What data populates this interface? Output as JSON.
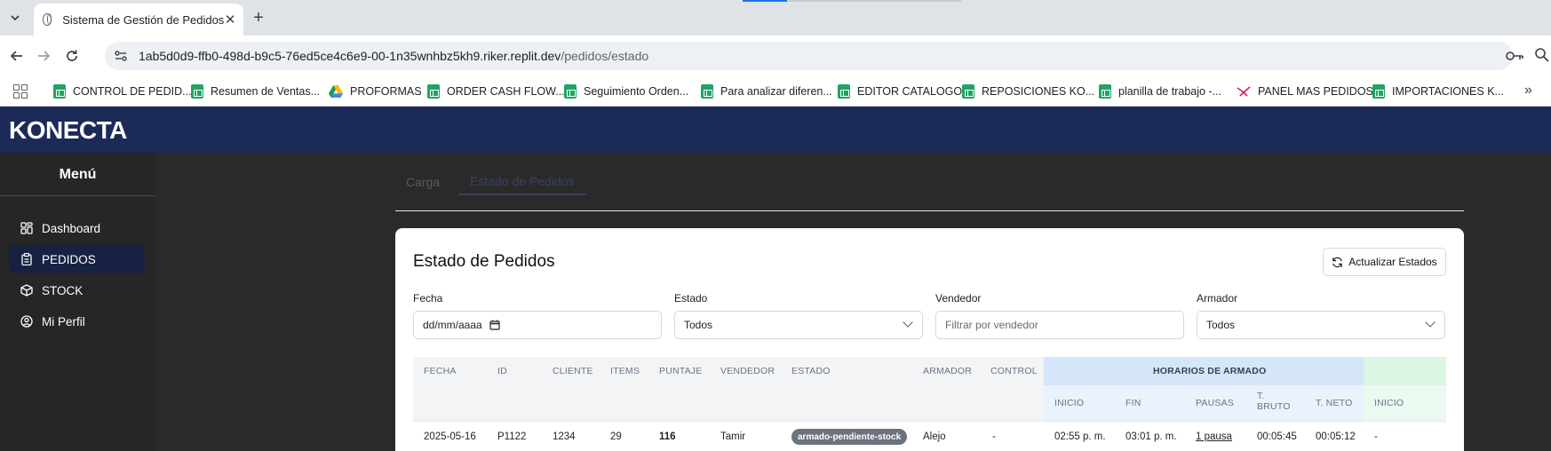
{
  "browser": {
    "tab_title": "Sistema de Gestión de Pedidos",
    "url_host": "1ab5d0d9-ffb0-498d-b9c5-76ed5ce4c6e9-00-1n35wnhbz5kh9.riker.replit.dev",
    "url_path": "/pedidos/estado",
    "bookmarks": [
      {
        "label": "CONTROL DE PEDID...",
        "icon": "sheets-icon"
      },
      {
        "label": "Resumen de Ventas...",
        "icon": "sheets-icon"
      },
      {
        "label": "PROFORMAS",
        "icon": "drive-icon"
      },
      {
        "label": "ORDER CASH FLOW...",
        "icon": "sheets-icon"
      },
      {
        "label": "Seguimiento Orden...",
        "icon": "sheets-icon"
      },
      {
        "label": "Para analizar diferen...",
        "icon": "sheets-icon"
      },
      {
        "label": "EDITOR CATALOGO",
        "icon": "sheets-icon"
      },
      {
        "label": "REPOSICIONES KO...",
        "icon": "sheets-icon"
      },
      {
        "label": "planilla de trabajo -...",
        "icon": "sheets-icon"
      },
      {
        "label": "PANEL MAS PEDIDOS",
        "icon": "panel-icon"
      },
      {
        "label": "IMPORTACIONES K...",
        "icon": "sheets-icon"
      }
    ],
    "more_bookmarks": "»"
  },
  "app": {
    "brand": "KONECTA",
    "menu_title": "Menú",
    "menu": [
      {
        "label": "Dashboard",
        "icon": "dashboard-icon"
      },
      {
        "label": "PEDIDOS",
        "icon": "clipboard-icon"
      },
      {
        "label": "STOCK",
        "icon": "box-icon"
      },
      {
        "label": "Mi Perfil",
        "icon": "user-circle-icon"
      }
    ],
    "tabs": [
      "Carga",
      "Estado de Pedidos"
    ],
    "card_title": "Estado de Pedidos",
    "refresh_label": "Actualizar Estados",
    "filters": {
      "fecha_label": "Fecha",
      "fecha_value": "dd/mm/aaaa",
      "estado_label": "Estado",
      "estado_value": "Todos",
      "vendedor_label": "Vendedor",
      "vendedor_placeholder": "Filtrar por vendedor",
      "armador_label": "Armador",
      "armador_value": "Todos"
    },
    "table": {
      "headers": [
        "FECHA",
        "ID",
        "CLIENTE",
        "ITEMS",
        "PUNTAJE",
        "VENDEDOR",
        "ESTADO",
        "ARMADOR",
        "CONTROL"
      ],
      "group_armado": "HORARIOS DE ARMADO",
      "sub_headers": [
        "INICIO",
        "FIN",
        "PAUSAS",
        "T. BRUTO",
        "T. NETO"
      ],
      "sub_headers_2": [
        "INICIO"
      ],
      "rows": [
        {
          "fecha": "2025-05-16",
          "id": "P1122",
          "cliente": "1234",
          "items": "29",
          "puntaje": "116",
          "vendedor": "Tamir",
          "estado": "armado-pendiente-stock",
          "armador": "Alejo",
          "control": "-",
          "inicio": "02:55 p. m.",
          "fin": "03:01 p. m.",
          "pausas": "1 pausa",
          "t_bruto": "00:05:45",
          "t_neto": "00:05:12",
          "inicio_2": "-"
        }
      ]
    },
    "colors": {
      "header_bg": "#1c2a57",
      "sidebar_active": "#172142",
      "badge_gray": "#6b7280",
      "armado_blue": "#d5e6fb",
      "control_green": "#d9f7e2"
    }
  }
}
